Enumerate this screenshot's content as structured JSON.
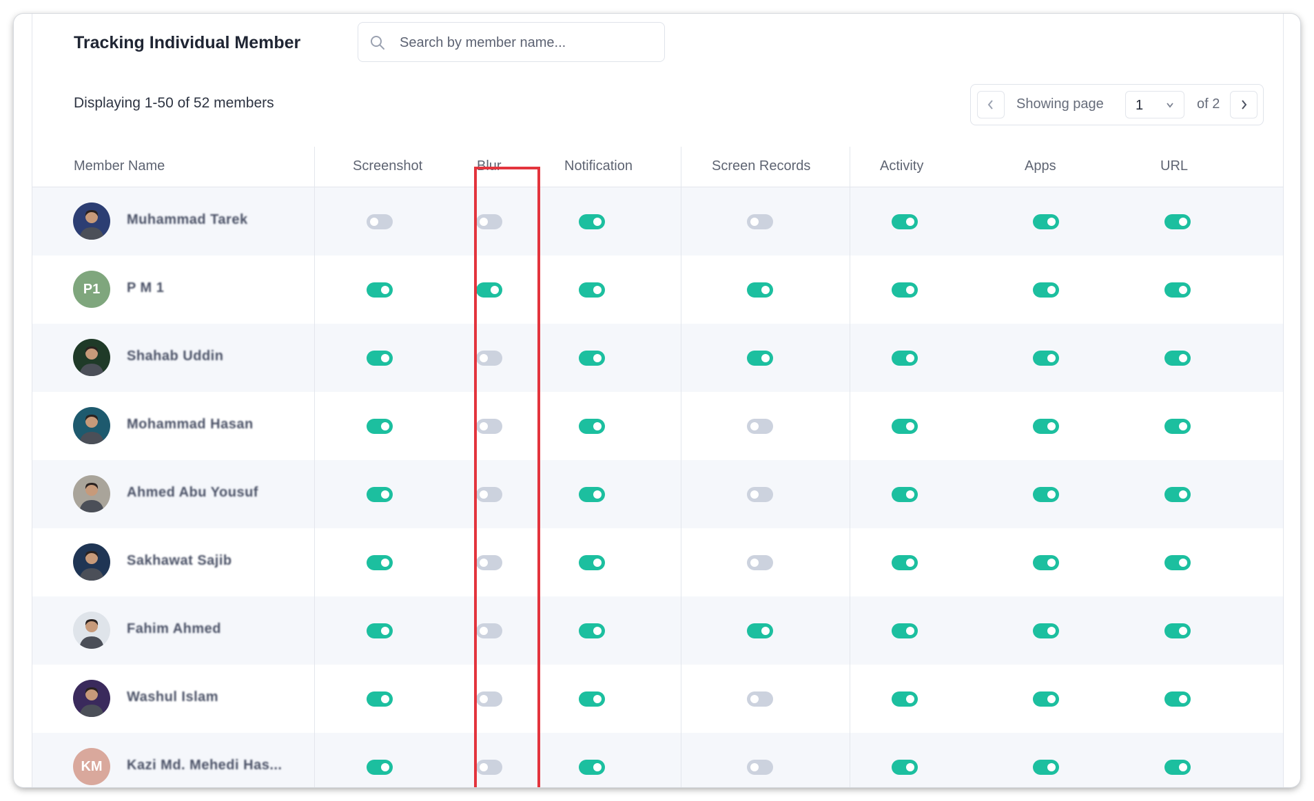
{
  "header": {
    "title": "Tracking Individual Member",
    "search_placeholder": "Search by member name..."
  },
  "summary": "Displaying 1-50 of 52 members",
  "pagination": {
    "showing_label": "Showing page",
    "current_page": "1",
    "of_label": "of 2"
  },
  "columns": [
    "Member Name",
    "Screenshot",
    "Blur",
    "Notification",
    "Screen Records",
    "Activity",
    "Apps",
    "URL"
  ],
  "colors": {
    "toggle_on": "#1cbf9f",
    "toggle_off": "#ccd2de",
    "highlight": "#e3343d"
  },
  "members": [
    {
      "name": "Muhammad Tarek",
      "initials": "",
      "avatar_color": "#2c3e73",
      "screenshot": false,
      "blur": false,
      "notification": true,
      "screen_records": false,
      "activity": true,
      "apps": true,
      "url": true
    },
    {
      "name": "P M 1",
      "initials": "P1",
      "avatar_color": "#7fa67d",
      "screenshot": true,
      "blur": true,
      "notification": true,
      "screen_records": true,
      "activity": true,
      "apps": true,
      "url": true
    },
    {
      "name": "Shahab Uddin",
      "initials": "",
      "avatar_color": "#1f3a28",
      "screenshot": true,
      "blur": false,
      "notification": true,
      "screen_records": true,
      "activity": true,
      "apps": true,
      "url": true
    },
    {
      "name": "Mohammad Hasan",
      "initials": "",
      "avatar_color": "#1e5a6e",
      "screenshot": true,
      "blur": false,
      "notification": true,
      "screen_records": false,
      "activity": true,
      "apps": true,
      "url": true
    },
    {
      "name": "Ahmed Abu Yousuf",
      "initials": "",
      "avatar_color": "#a9a49a",
      "screenshot": true,
      "blur": false,
      "notification": true,
      "screen_records": false,
      "activity": true,
      "apps": true,
      "url": true
    },
    {
      "name": "Sakhawat Sajib",
      "initials": "",
      "avatar_color": "#1f3554",
      "screenshot": true,
      "blur": false,
      "notification": true,
      "screen_records": false,
      "activity": true,
      "apps": true,
      "url": true
    },
    {
      "name": "Fahim Ahmed",
      "initials": "",
      "avatar_color": "#dfe4ea",
      "screenshot": true,
      "blur": false,
      "notification": true,
      "screen_records": true,
      "activity": true,
      "apps": true,
      "url": true
    },
    {
      "name": "Washul Islam",
      "initials": "",
      "avatar_color": "#3a2a5c",
      "screenshot": true,
      "blur": false,
      "notification": true,
      "screen_records": false,
      "activity": true,
      "apps": true,
      "url": true
    },
    {
      "name": "Kazi Md. Mehedi Has...",
      "initials": "KM",
      "avatar_color": "#d9a89c",
      "screenshot": true,
      "blur": false,
      "notification": true,
      "screen_records": false,
      "activity": true,
      "apps": true,
      "url": true
    }
  ]
}
